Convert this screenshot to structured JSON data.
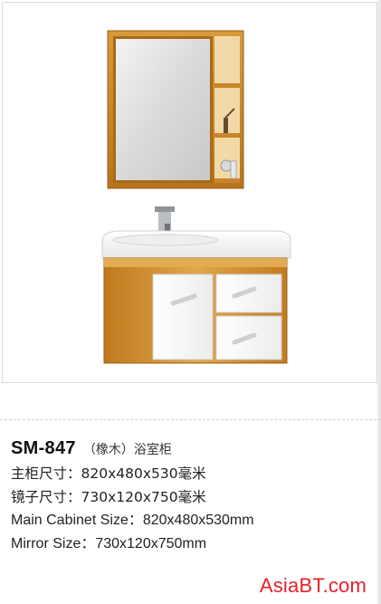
{
  "product": {
    "model": "SM-847",
    "subtitle": "（橡木）浴室柜",
    "specs": [
      "主柜尺寸：820x480x530毫米",
      "镜子尺寸：730x120x750毫米",
      "Main Cabinet Size：820x480x530mm",
      "Mirror Size：730x120x750mm"
    ]
  },
  "brand": {
    "name": "AsiaBT",
    "tld": ".com"
  },
  "colors": {
    "brand": "#e8202b",
    "oak": "#d4952f",
    "cabinet_white": "#ffffff"
  },
  "image": {
    "subject": "oak-bathroom-cabinet-with-mirror"
  }
}
